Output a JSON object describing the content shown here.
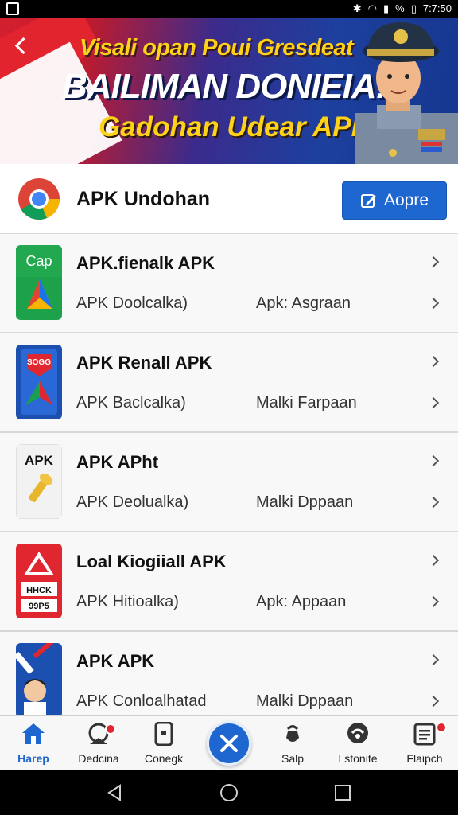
{
  "status_bar": {
    "battery": "%",
    "time": "7:7:50"
  },
  "banner": {
    "line1": "Visali opan Poui Gresdeat",
    "line2": "BAILIMAN DONIEIA!",
    "line3": "Gadohan Udear APK"
  },
  "header": {
    "title": "APK Undohan",
    "action_label": "Aopre"
  },
  "list": [
    {
      "name": "APK.fienalk APK",
      "sub1": "APK Doolcalka)",
      "sub2": "Apk: Asgraan",
      "icon": "maps-app-icon",
      "icon_text": "Cap"
    },
    {
      "name": "APK Renall APK",
      "sub1": "APK Baclcalka)",
      "sub2": "Malki Farpaan",
      "icon": "navigation-app-icon",
      "icon_text": "SOGG"
    },
    {
      "name": "APK APht",
      "sub1": "APK Deolualka)",
      "sub2": "Malki Dppaan",
      "icon": "key-app-icon",
      "icon_text": "APK"
    },
    {
      "name": "Loal Kiogiiall APK",
      "sub1": "APK Hitioalka)",
      "sub2": "Apk: Appaan",
      "icon": "warning-app-icon",
      "icon_text": "HHCK",
      "icon_text2": "99P5"
    },
    {
      "name": "APK APK",
      "sub1": "APK Conloalhatad",
      "sub2": "Malki Dppaan",
      "icon": "avatar-app-icon"
    }
  ],
  "bottom_nav": [
    {
      "label": "Harep",
      "icon": "home-icon",
      "active": true
    },
    {
      "label": "Dedcina",
      "icon": "notification-icon",
      "badge": true
    },
    {
      "label": "Conegk",
      "icon": "device-icon"
    },
    {
      "label": "Salp",
      "icon": "hand-icon"
    },
    {
      "label": "Lstonite",
      "icon": "chat-icon"
    },
    {
      "label": "Flaipch",
      "icon": "document-icon",
      "badge": true
    }
  ],
  "colors": {
    "accent": "#1e66d0",
    "badge": "#e0262f",
    "banner_yellow": "#ffd21a"
  }
}
